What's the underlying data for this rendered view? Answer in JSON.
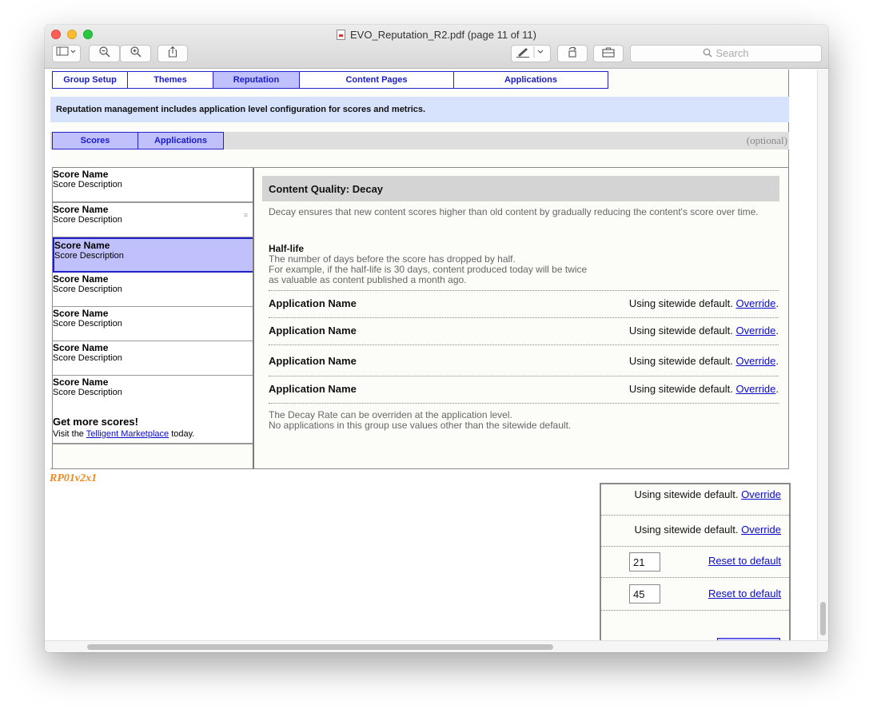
{
  "window": {
    "title": "EVO_Reputation_R2.pdf (page 11 of 11)",
    "search_placeholder": "Search"
  },
  "toolbar": {
    "sidebar_icon": "sidebar-toggle-icon",
    "zoom_out_icon": "zoom-out-icon",
    "zoom_in_icon": "zoom-in-icon",
    "share_icon": "share-icon",
    "annotate_icon": "pen-icon",
    "rotate_icon": "rotate-icon",
    "toolbox_icon": "toolbox-icon"
  },
  "nav_tabs": [
    "Group Setup",
    "Themes",
    "Reputation",
    "Content Pages",
    "Applications"
  ],
  "active_nav_tab": "Reputation",
  "info_text": "Reputation management includes application level configuration for scores and metrics.",
  "sub_tabs": [
    "Scores",
    "Applications"
  ],
  "optional_label": "(optional)",
  "scores": [
    {
      "name": "Score Name",
      "description": "Score Description"
    },
    {
      "name": "Score Name",
      "description": "Score Description"
    },
    {
      "name": "Score Name",
      "description": "Score Description"
    },
    {
      "name": "Score Name",
      "description": "Score Description"
    },
    {
      "name": "Score Name",
      "description": "Score Description"
    },
    {
      "name": "Score Name",
      "description": "Score Description"
    },
    {
      "name": "Score Name",
      "description": "Score Description"
    }
  ],
  "selected_score_index": 2,
  "get_more": {
    "title": "Get more scores!",
    "prefix": "Visit the ",
    "link": "Telligent Marketplace",
    "suffix": " today."
  },
  "panel": {
    "title": "Content Quality: Decay",
    "description": "Decay ensures that new content scores higher than old content by gradually reducing the content's score over time.",
    "half_life_title": "Half-life",
    "half_life_lines": [
      "The number of days before the score has dropped by half.",
      "For example, if the half-life is 30 days, content produced today will be twice",
      "as valuable as content published a month ago."
    ],
    "apps": [
      {
        "name": "Application Name",
        "status": "Using sitewide default. ",
        "link": "Override",
        "end": "."
      },
      {
        "name": "Application Name",
        "status": "Using sitewide default. ",
        "link": "Override",
        "end": "."
      },
      {
        "name": "Application Name",
        "status": "Using sitewide default. ",
        "link": "Override",
        "end": "."
      },
      {
        "name": "Application Name",
        "status": "Using sitewide default. ",
        "link": "Override",
        "end": "."
      }
    ],
    "footnote_lines": [
      "The Decay Rate can be overriden at the application level.",
      "No applications in this group use values other than the sitewide default."
    ]
  },
  "wireframe_label": "RP01v2x1",
  "override_box": {
    "rows": [
      {
        "status": "Using sitewide default. ",
        "link": "Override"
      },
      {
        "status": "Using sitewide default. ",
        "link": "Override"
      }
    ],
    "inputs": [
      {
        "value": "21",
        "reset": "Reset to default"
      },
      {
        "value": "45",
        "reset": "Reset to default"
      }
    ]
  }
}
